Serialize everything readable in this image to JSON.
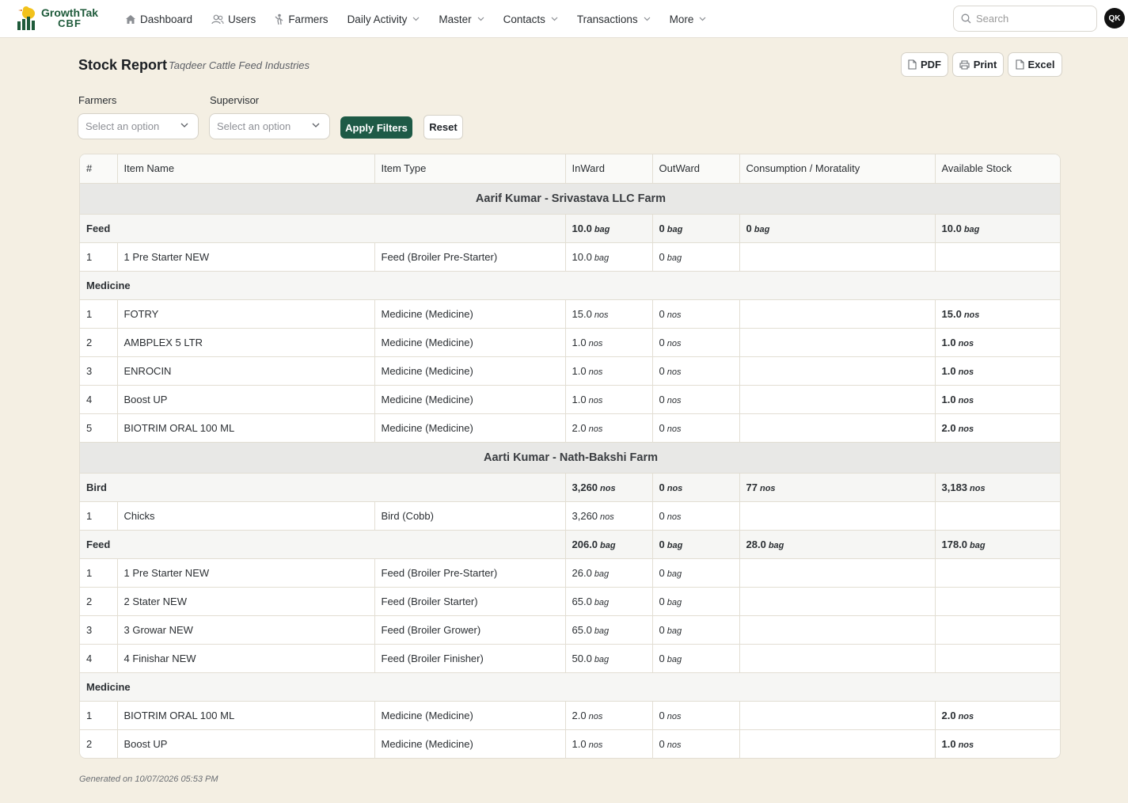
{
  "app": {
    "logo_line1": "GrowthTak",
    "logo_line2": "CBF"
  },
  "nav": {
    "items": [
      {
        "label": "Dashboard",
        "icon": "home-icon",
        "dropdown": false
      },
      {
        "label": "Users",
        "icon": "users-icon",
        "dropdown": false
      },
      {
        "label": "Farmers",
        "icon": "farmer-icon",
        "dropdown": false
      },
      {
        "label": "Daily Activity",
        "dropdown": true
      },
      {
        "label": "Master",
        "dropdown": true
      },
      {
        "label": "Contacts",
        "dropdown": true
      },
      {
        "label": "Transactions",
        "dropdown": true
      },
      {
        "label": "More",
        "dropdown": true
      }
    ],
    "search_placeholder": "Search",
    "avatar_initials": "QK"
  },
  "page": {
    "title": "Stock Report",
    "subtitle": "Taqdeer Cattle Feed Industries",
    "actions": {
      "pdf": "PDF",
      "print": "Print",
      "excel": "Excel"
    },
    "footer": "Generated on 10/07/2026 05:53 PM"
  },
  "filters": {
    "farmers_label": "Farmers",
    "supervisor_label": "Supervisor",
    "farmers_value": "Select an option",
    "supervisor_value": "Select an option",
    "apply_label": "Apply Filters",
    "reset_label": "Reset"
  },
  "table": {
    "columns": [
      "#",
      "Item Name",
      "Item Type",
      "InWard",
      "OutWard",
      "Consumption / Moratality",
      "Available Stock"
    ],
    "farm1": {
      "name": "Aarif Kumar - Srivastava LLC Farm",
      "feed": {
        "label": "Feed",
        "totals": {
          "in": "10.0",
          "in_u": "bag",
          "out": "0",
          "out_u": "bag",
          "cons": "0",
          "cons_u": "bag",
          "avail": "10.0",
          "avail_u": "bag"
        },
        "rows": [
          {
            "n": "1",
            "name": "1 Pre Starter NEW",
            "type": "Feed (Broiler Pre-Starter)",
            "in": "10.0",
            "in_u": "bag",
            "out": "0",
            "out_u": "bag"
          }
        ]
      },
      "medicine": {
        "label": "Medicine",
        "rows": [
          {
            "n": "1",
            "name": "FOTRY",
            "type": "Medicine (Medicine)",
            "in": "15.0",
            "in_u": "nos",
            "out": "0",
            "out_u": "nos",
            "avail": "15.0",
            "avail_u": "nos"
          },
          {
            "n": "2",
            "name": "AMBPLEX 5 LTR",
            "type": "Medicine (Medicine)",
            "in": "1.0",
            "in_u": "nos",
            "out": "0",
            "out_u": "nos",
            "avail": "1.0",
            "avail_u": "nos"
          },
          {
            "n": "3",
            "name": "ENROCIN",
            "type": "Medicine (Medicine)",
            "in": "1.0",
            "in_u": "nos",
            "out": "0",
            "out_u": "nos",
            "avail": "1.0",
            "avail_u": "nos"
          },
          {
            "n": "4",
            "name": "Boost UP",
            "type": "Medicine (Medicine)",
            "in": "1.0",
            "in_u": "nos",
            "out": "0",
            "out_u": "nos",
            "avail": "1.0",
            "avail_u": "nos"
          },
          {
            "n": "5",
            "name": "BIOTRIM ORAL 100 ML",
            "type": "Medicine (Medicine)",
            "in": "2.0",
            "in_u": "nos",
            "out": "0",
            "out_u": "nos",
            "avail": "2.0",
            "avail_u": "nos"
          }
        ]
      }
    },
    "farm2": {
      "name": "Aarti Kumar - Nath-Bakshi Farm",
      "bird": {
        "label": "Bird",
        "totals": {
          "in": "3,260",
          "in_u": "nos",
          "out": "0",
          "out_u": "nos",
          "cons": "77",
          "cons_u": "nos",
          "avail": "3,183",
          "avail_u": "nos"
        },
        "rows": [
          {
            "n": "1",
            "name": "Chicks",
            "type": "Bird (Cobb)",
            "in": "3,260",
            "in_u": "nos",
            "out": "0",
            "out_u": "nos"
          }
        ]
      },
      "feed": {
        "label": "Feed",
        "totals": {
          "in": "206.0",
          "in_u": "bag",
          "out": "0",
          "out_u": "bag",
          "cons": "28.0",
          "cons_u": "bag",
          "avail": "178.0",
          "avail_u": "bag"
        },
        "rows": [
          {
            "n": "1",
            "name": "1 Pre Starter NEW",
            "type": "Feed (Broiler Pre-Starter)",
            "in": "26.0",
            "in_u": "bag",
            "out": "0",
            "out_u": "bag"
          },
          {
            "n": "2",
            "name": "2 Stater NEW",
            "type": "Feed (Broiler Starter)",
            "in": "65.0",
            "in_u": "bag",
            "out": "0",
            "out_u": "bag"
          },
          {
            "n": "3",
            "name": "3 Growar NEW",
            "type": "Feed (Broiler Grower)",
            "in": "65.0",
            "in_u": "bag",
            "out": "0",
            "out_u": "bag"
          },
          {
            "n": "4",
            "name": "4 Finishar NEW",
            "type": "Feed (Broiler Finisher)",
            "in": "50.0",
            "in_u": "bag",
            "out": "0",
            "out_u": "bag"
          }
        ]
      },
      "medicine": {
        "label": "Medicine",
        "rows": [
          {
            "n": "1",
            "name": "BIOTRIM ORAL 100 ML",
            "type": "Medicine (Medicine)",
            "in": "2.0",
            "in_u": "nos",
            "out": "0",
            "out_u": "nos",
            "avail": "2.0",
            "avail_u": "nos"
          },
          {
            "n": "2",
            "name": "Boost UP",
            "type": "Medicine (Medicine)",
            "in": "1.0",
            "in_u": "nos",
            "out": "0",
            "out_u": "nos",
            "avail": "1.0",
            "avail_u": "nos"
          }
        ]
      }
    }
  }
}
